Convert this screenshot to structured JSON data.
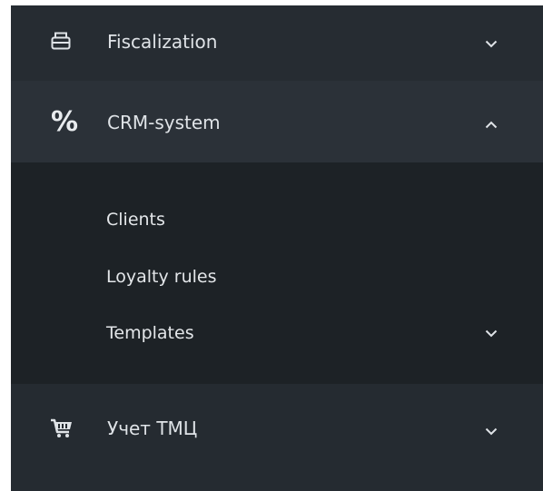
{
  "menu": {
    "fiscalization": {
      "label": "Fiscalization",
      "icon": "printer-icon",
      "expanded": false
    },
    "crm": {
      "label": "CRM-system",
      "icon": "percent-icon",
      "icon_glyph": "%",
      "expanded": true,
      "items": [
        {
          "label": "Clients"
        },
        {
          "label": "Loyalty rules"
        },
        {
          "label": "Templates",
          "has_submenu": true,
          "expanded": false
        }
      ]
    },
    "inventory": {
      "label": "Учет ТМЦ",
      "icon": "cart-icon",
      "expanded": false
    }
  },
  "colors": {
    "sidebar_bg": "#252b31",
    "active_row_bg": "#2b3138",
    "submenu_bg": "#1d2226",
    "text": "#dfe3e7"
  }
}
